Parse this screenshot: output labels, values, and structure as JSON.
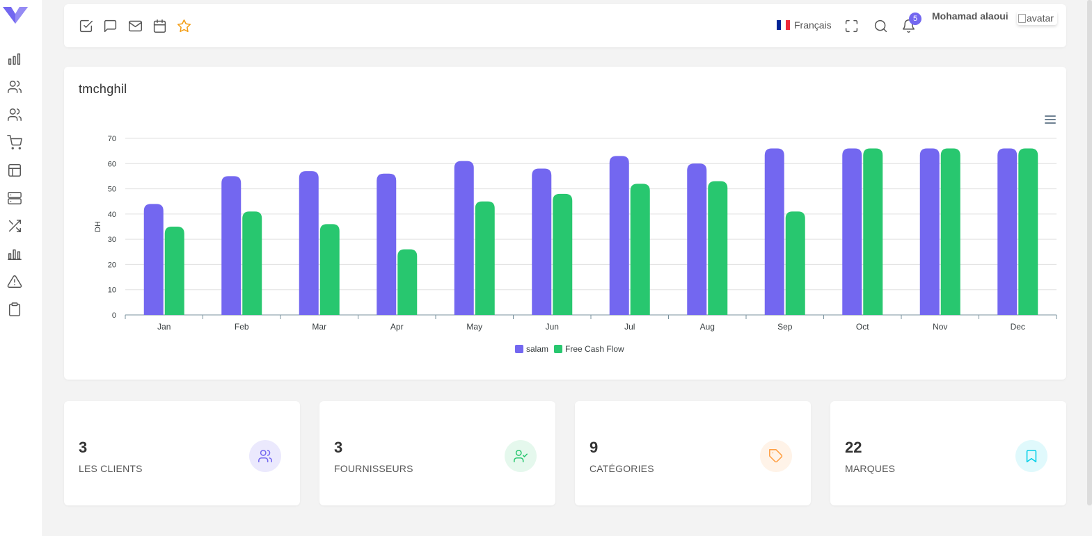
{
  "navbar": {
    "language": "Français",
    "notification_count": "5",
    "username": "Mohamad alaoui",
    "avatar_alt": "avatar"
  },
  "chart_title": "tmchghil",
  "chart_data": {
    "type": "bar",
    "title": "tmchghil",
    "xlabel": "",
    "ylabel": "DH",
    "ylim": [
      0,
      70
    ],
    "yticks": [
      0,
      10,
      20,
      30,
      40,
      50,
      60,
      70
    ],
    "categories": [
      "Jan",
      "Feb",
      "Mar",
      "Apr",
      "May",
      "Jun",
      "Jul",
      "Aug",
      "Sep",
      "Oct",
      "Nov",
      "Dec"
    ],
    "series": [
      {
        "name": "salam",
        "color": "#7367f0",
        "values": [
          44,
          55,
          57,
          56,
          61,
          58,
          63,
          60,
          66,
          66,
          66,
          66
        ]
      },
      {
        "name": "Free Cash Flow",
        "color": "#28c76f",
        "values": [
          35,
          41,
          36,
          26,
          45,
          48,
          52,
          53,
          41,
          66,
          66,
          66
        ]
      }
    ],
    "grid": true,
    "legend_position": "bottom"
  },
  "stats": [
    {
      "value": "3",
      "label": "LES CLIENTS",
      "icon": "users-icon",
      "color": "#7367f0",
      "bg": "#ebe9fd"
    },
    {
      "value": "3",
      "label": "FOURNISSEURS",
      "icon": "user-check-icon",
      "color": "#28c76f",
      "bg": "#e5f8ed"
    },
    {
      "value": "9",
      "label": "CATÉGORIES",
      "icon": "tag-icon",
      "color": "#ff9f43",
      "bg": "#fff3e8"
    },
    {
      "value": "22",
      "label": "MARQUES",
      "icon": "bookmark-icon",
      "color": "#00cfe8",
      "bg": "#e0f9fc"
    }
  ]
}
